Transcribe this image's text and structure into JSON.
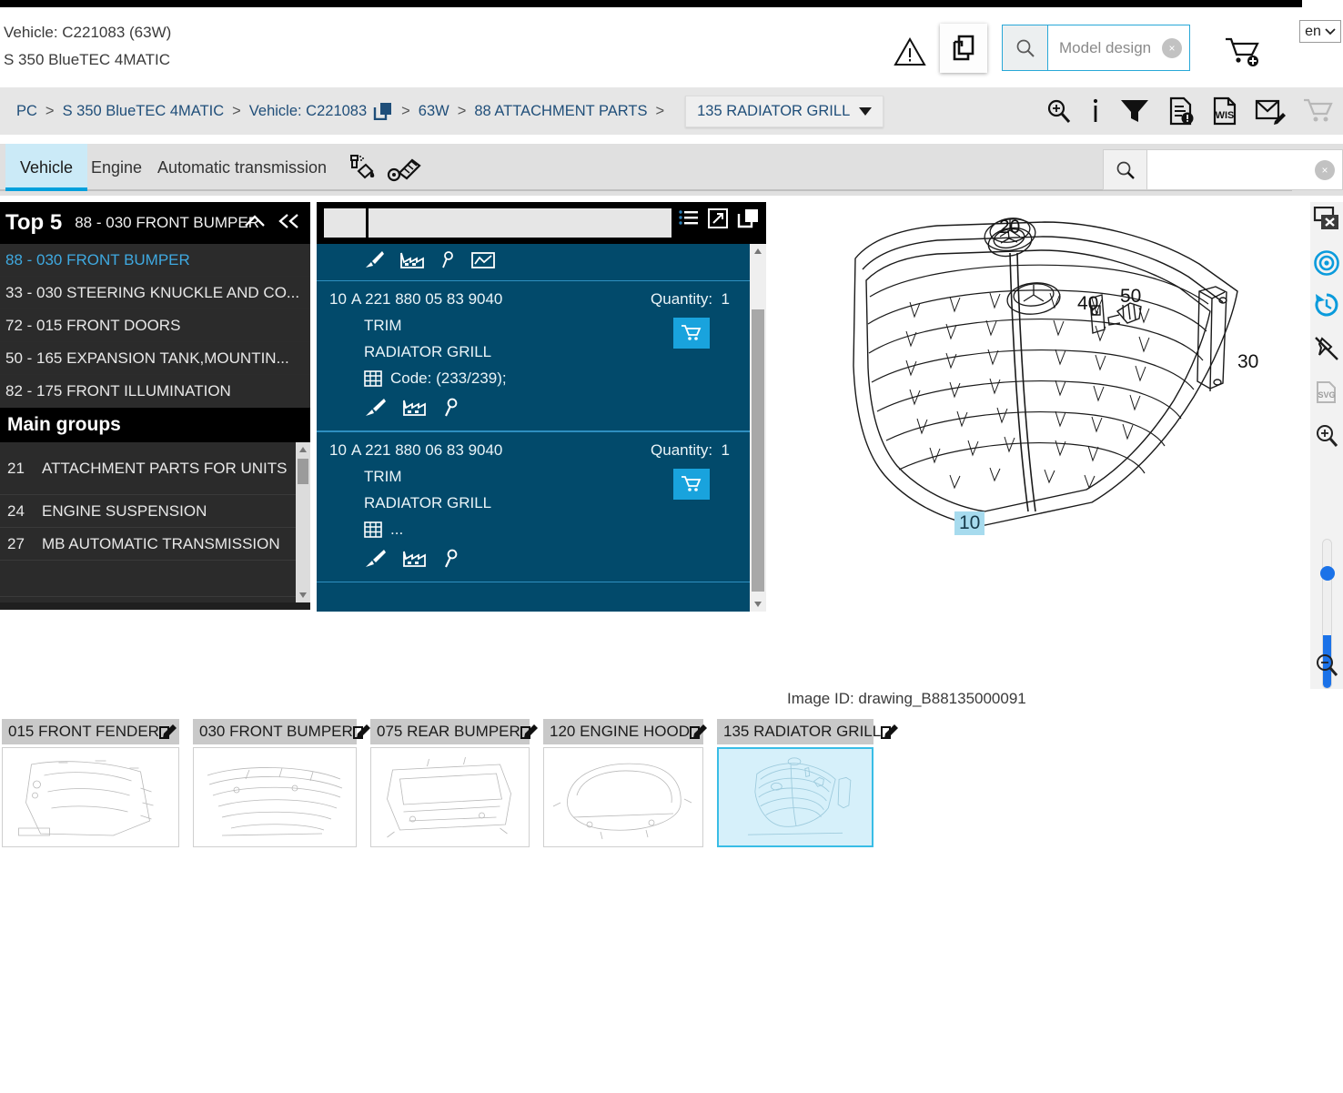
{
  "header": {
    "vehicle_line1": "Vehicle: C221083 (63W)",
    "vehicle_line2": "S 350 BlueTEC 4MATIC",
    "warning_icon": "warning-triangle-icon",
    "copy_icon": "copy-documents-icon",
    "model_search_placeholder": "Model design",
    "model_search_value": "",
    "clear_label": "×",
    "cart_icon": "add-to-cart-icon",
    "language": "en"
  },
  "breadcrumb": {
    "items": [
      "PC",
      "S 350 BlueTEC 4MATIC",
      "Vehicle: C221083",
      "63W",
      "88 ATTACHMENT PARTS"
    ],
    "separator": ">",
    "current": "135 RADIATOR GRILL",
    "tools": [
      "zoom-search-icon",
      "info-icon",
      "filter-icon",
      "document-alert-icon",
      "wis-document-icon",
      "mail-edit-icon",
      "cart-icon"
    ]
  },
  "tabs": {
    "items": [
      {
        "label": "Vehicle",
        "active": true
      },
      {
        "label": "Engine",
        "active": false
      },
      {
        "label": "Automatic transmission",
        "active": false
      }
    ],
    "icons": [
      "paint-code-icon",
      "engine-code-icon"
    ],
    "search_placeholder": "",
    "search_value": ""
  },
  "sidebar": {
    "top5": {
      "title": "Top 5",
      "subtitle": "88 - 030 FRONT BUMPER",
      "collapse_icon": "chevron-up-icon",
      "collapse_all_icon": "double-chevron-left-icon",
      "items": [
        {
          "label": "88 - 030 FRONT BUMPER",
          "selected": true
        },
        {
          "label": "33 - 030 STEERING KNUCKLE AND CO...",
          "selected": false
        },
        {
          "label": "72 - 015 FRONT DOORS",
          "selected": false
        },
        {
          "label": "50 - 165 EXPANSION TANK,MOUNTIN...",
          "selected": false
        },
        {
          "label": "82 - 175 FRONT ILLUMINATION",
          "selected": false
        }
      ]
    },
    "main_groups": {
      "title": "Main groups",
      "items": [
        {
          "num": "21",
          "label": "ATTACHMENT PARTS FOR UNITS"
        },
        {
          "num": "24",
          "label": "ENGINE SUSPENSION"
        },
        {
          "num": "27",
          "label": "MB AUTOMATIC TRANSMISSION"
        }
      ]
    }
  },
  "parts_panel": {
    "toolbar_icons": [
      "list-view-icon",
      "expand-icon",
      "copy-icon"
    ],
    "items": [
      {
        "index": "10",
        "part_number": "A 221 880 05 83 9040",
        "name": "TRIM",
        "description": "RADIATOR GRILL",
        "code": "Code: (233/239);",
        "quantity_label": "Quantity:",
        "quantity": "1",
        "cart_icon": "add-to-cart-icon",
        "row_icons": [
          "paint-brush-icon",
          "factory-icon",
          "key-search-icon"
        ]
      },
      {
        "index": "10",
        "part_number": "A 221 880 06 83 9040",
        "name": "TRIM",
        "description": "RADIATOR GRILL",
        "code": "...",
        "quantity_label": "Quantity:",
        "quantity": "1",
        "cart_icon": "add-to-cart-icon",
        "row_icons": [
          "paint-brush-icon",
          "factory-icon",
          "key-search-icon"
        ]
      }
    ]
  },
  "drawing": {
    "image_id": "Image ID: drawing_B88135000091",
    "callouts": [
      {
        "label": "20",
        "highlighted": false
      },
      {
        "label": "40",
        "highlighted": false
      },
      {
        "label": "50",
        "highlighted": false
      },
      {
        "label": "30",
        "highlighted": false
      },
      {
        "label": "10",
        "highlighted": true
      }
    ]
  },
  "vertical_toolbar": {
    "buttons": [
      "close-window-icon",
      "target-hotspot-icon",
      "history-reset-icon",
      "unpin-icon",
      "svg-export-icon",
      "zoom-in-icon",
      "zoom-out-icon"
    ]
  },
  "thumbnails": [
    {
      "label": "015 FRONT FENDER",
      "edit_icon": "edit-icon",
      "selected": false
    },
    {
      "label": "030 FRONT BUMPER",
      "edit_icon": "edit-icon",
      "selected": false
    },
    {
      "label": "075 REAR BUMPER",
      "edit_icon": "edit-icon",
      "selected": false
    },
    {
      "label": "120 ENGINE HOOD",
      "edit_icon": "edit-icon",
      "selected": false
    },
    {
      "label": "135 RADIATOR GRILL",
      "edit_icon": "edit-icon",
      "selected": true
    }
  ],
  "colors": {
    "accent_blue": "#00a0dc",
    "panel_dark": "#00425f",
    "breadcrumb_link": "#1f4e79",
    "highlight": "#a7dbee"
  }
}
